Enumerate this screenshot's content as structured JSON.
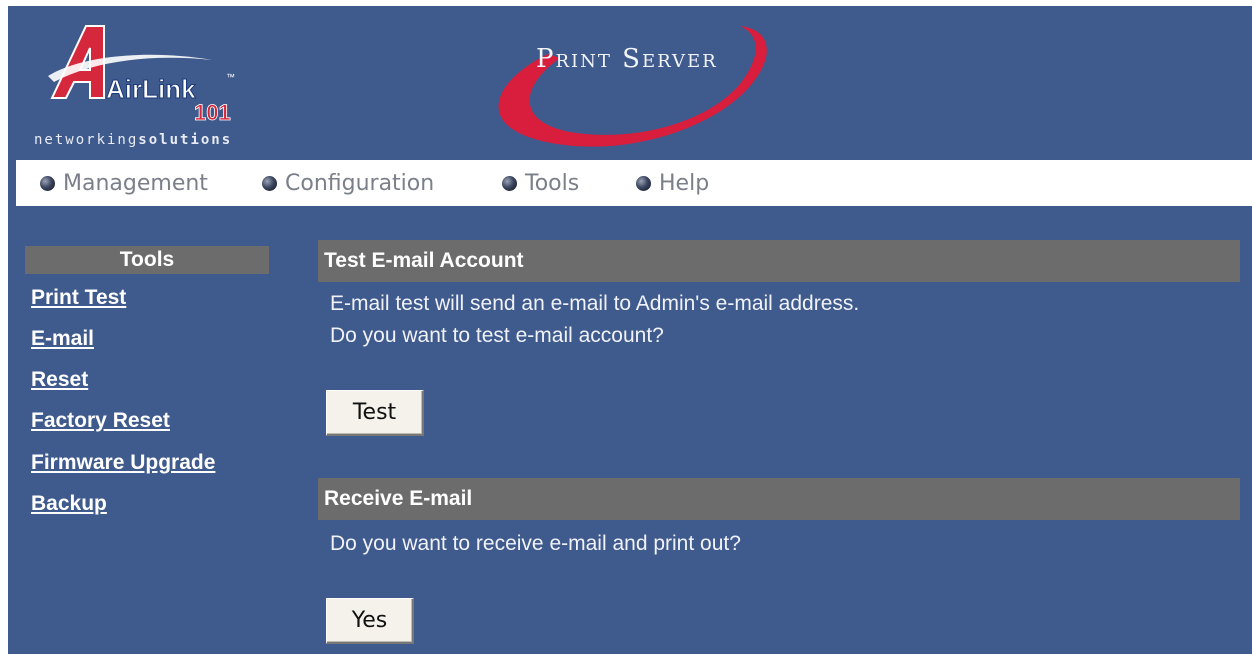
{
  "header": {
    "logo_text": "AirLink",
    "logo_number": "101",
    "logo_tm": "™",
    "logo_sub_light": "networking",
    "logo_sub_bold": "solutions",
    "brand_title": "Print Server"
  },
  "nav": {
    "items": [
      {
        "label": "Management"
      },
      {
        "label": "Configuration"
      },
      {
        "label": "Tools"
      },
      {
        "label": "Help"
      }
    ]
  },
  "sidebar": {
    "title": "Tools",
    "items": [
      {
        "label": "Print Test"
      },
      {
        "label": "E-mail"
      },
      {
        "label": "Reset"
      },
      {
        "label": "Factory Reset"
      },
      {
        "label": "Firmware Upgrade"
      },
      {
        "label": "Backup"
      }
    ]
  },
  "main": {
    "test_email": {
      "title": "Test E-mail Account",
      "line1": "E-mail test will send an e-mail to Admin's e-mail address.",
      "line2": "Do you want to test e-mail account?",
      "button": "Test"
    },
    "receive_email": {
      "title": "Receive E-mail",
      "line1": "Do you want to receive e-mail and print out?",
      "button": "Yes"
    }
  },
  "colors": {
    "background": "#3f5a8c",
    "section_header": "#6c6c6c",
    "brand_red": "#d81e3c"
  }
}
